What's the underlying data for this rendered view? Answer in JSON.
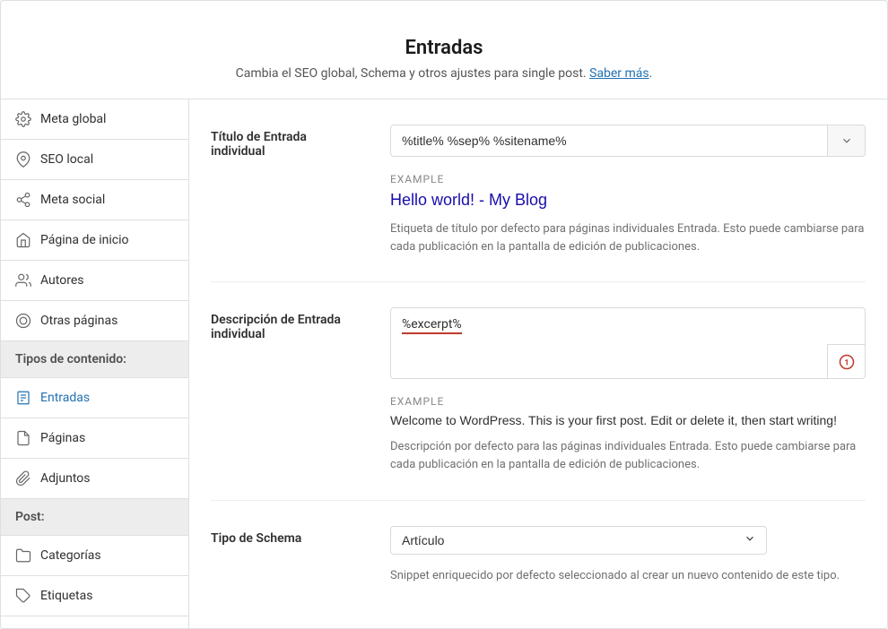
{
  "header": {
    "title": "Entradas",
    "subtitle_prefix": "Cambia el SEO global, Schema y otros ajustes para single post. ",
    "learn_more": "Saber más",
    "learn_more_suffix": "."
  },
  "sidebar": {
    "items_top": [
      {
        "label": "Meta global",
        "icon": "gear"
      },
      {
        "label": "SEO local",
        "icon": "location"
      },
      {
        "label": "Meta social",
        "icon": "share"
      },
      {
        "label": "Página de inicio",
        "icon": "home"
      },
      {
        "label": "Autores",
        "icon": "people"
      },
      {
        "label": "Otras páginas",
        "icon": "layers"
      }
    ],
    "heading_content": "Tipos de contenido:",
    "items_content": [
      {
        "label": "Entradas",
        "icon": "post",
        "active": true
      },
      {
        "label": "Páginas",
        "icon": "page"
      },
      {
        "label": "Adjuntos",
        "icon": "clip"
      }
    ],
    "heading_post": "Post:",
    "items_post": [
      {
        "label": "Categorías",
        "icon": "folder"
      },
      {
        "label": "Etiquetas",
        "icon": "tag"
      }
    ]
  },
  "fields": {
    "title": {
      "label": "Título de Entrada individual",
      "value": "%title% %sep% %sitename%",
      "example_label": "EXAMPLE",
      "example_value": "Hello world! - My Blog",
      "help": "Etiqueta de título por defecto para páginas individuales Entrada. Esto puede cambiarse para cada publicación en la pantalla de edición de publicaciones."
    },
    "description": {
      "label": "Descripción de Entrada individual",
      "value": "%excerpt%",
      "example_label": "EXAMPLE",
      "example_value": "Welcome to WordPress. This is your first post. Edit or delete it, then start writing!",
      "help": "Descripción por defecto para las páginas individuales Entrada. Esto puede cambiarse para cada publicación en la pantalla de edición de publicaciones."
    },
    "schema": {
      "label": "Tipo de Schema",
      "value": "Artículo",
      "help": "Snippet enriquecido por defecto seleccionado al crear un nuevo contenido de este tipo."
    }
  }
}
